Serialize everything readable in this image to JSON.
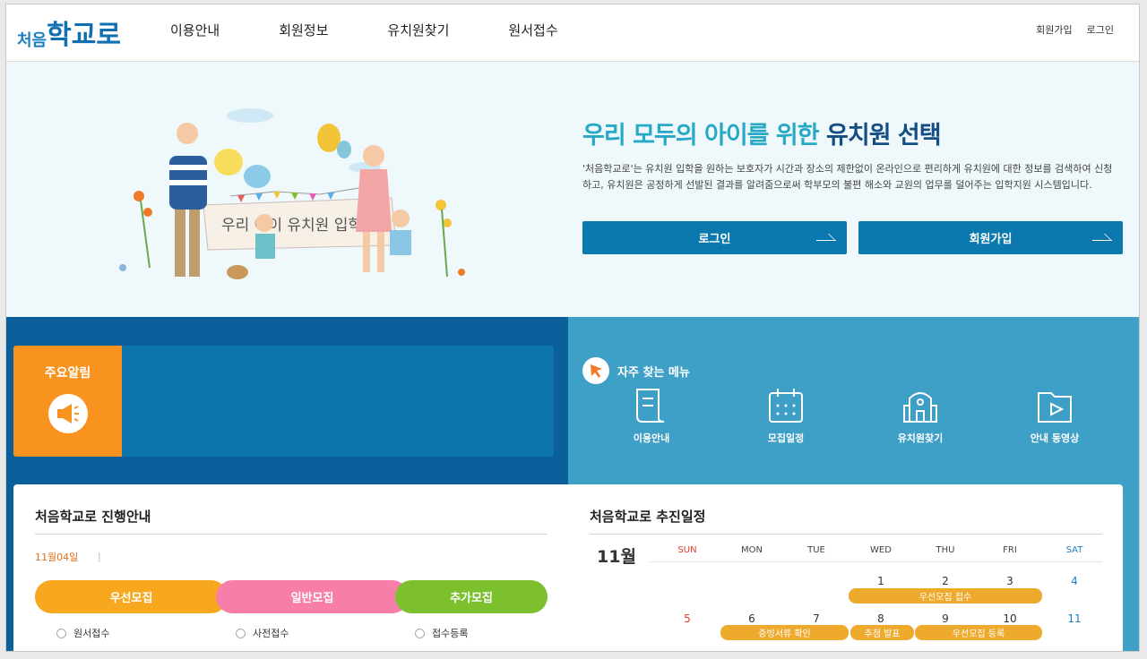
{
  "header": {
    "logo": {
      "small": "처음",
      "big": "학교로"
    },
    "nav": [
      "이용안내",
      "회원정보",
      "유치원찾기",
      "원서접수"
    ],
    "util": [
      "회원가입",
      "로그인"
    ]
  },
  "hero": {
    "banner_text": "우리 아이 유치원 입학",
    "title_part1": "우리 모두의 아이를 위한",
    "title_part2": "유치원 선택",
    "desc": "'처음학교로'는 유치원 입학을 원하는 보호자가 시간과 장소의 제한없이 온라인으로 편리하게 유치원에 대한 정보를 검색하여 신청하고, 유치원은 공정하게 선발된 결과를 알려줌으로써 학부모의 불편 해소와 교원의 업무를 덜어주는 입학지원 시스템입니다.",
    "login_label": "로그인",
    "join_label": "회원가입"
  },
  "notice": {
    "label": "주요알림"
  },
  "quick": {
    "title": "자주 찾는 메뉴",
    "items": [
      "이용안내",
      "모집일정",
      "유치원찾기",
      "안내 동영상"
    ]
  },
  "progress": {
    "title": "처음학교로 진행안내",
    "date": "11월04일",
    "sep": "|",
    "pills": [
      {
        "label": "우선모집",
        "color": "#f8a81e"
      },
      {
        "label": "일반모집",
        "color": "#f67ea8"
      },
      {
        "label": "추가모집",
        "color": "#7cc02e"
      }
    ],
    "steps": [
      "원서접수",
      "사전접수",
      "접수등록"
    ]
  },
  "calendar": {
    "title": "처음학교로 추진일정",
    "month": "11월",
    "dow": [
      "SUN",
      "MON",
      "TUE",
      "WED",
      "THU",
      "FRI",
      "SAT"
    ],
    "week1": [
      "1",
      "2",
      "3",
      "4"
    ],
    "week2": [
      "5",
      "6",
      "7",
      "8",
      "9",
      "10",
      "11"
    ],
    "events": [
      "우선모집 접수",
      "증빙서류 확인",
      "추첨 발표",
      "우선모집 등록"
    ],
    "colors": {
      "sun": "#e23b2a",
      "sat": "#1a7fc1",
      "event": "#eeaa2d"
    }
  }
}
